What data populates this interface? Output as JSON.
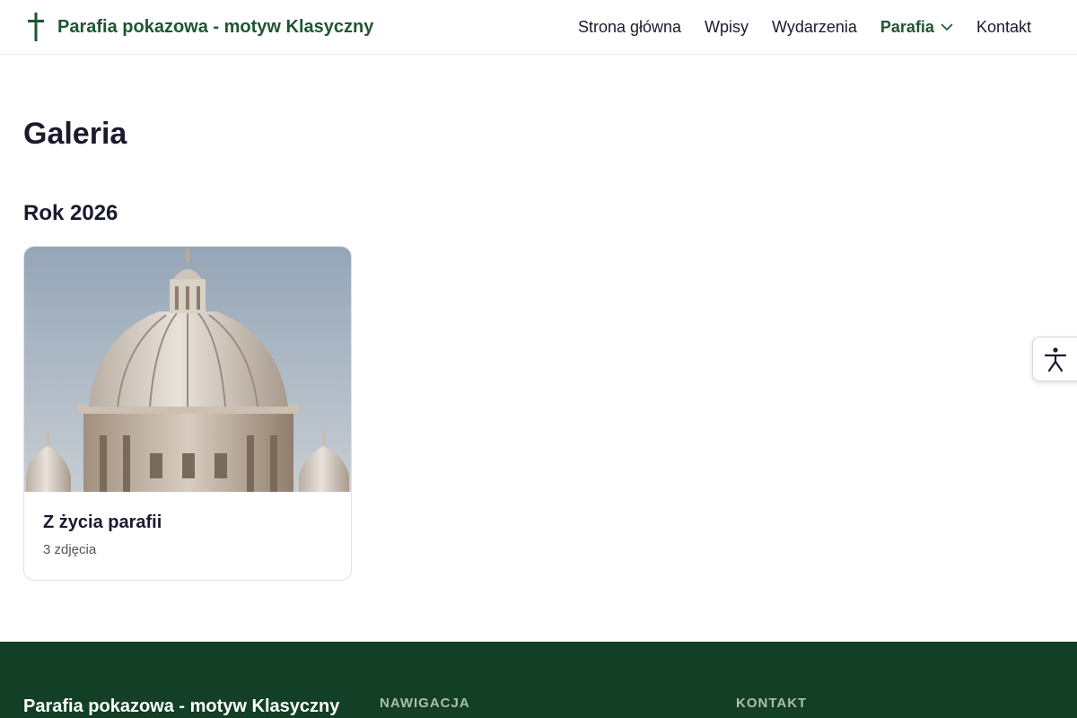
{
  "header": {
    "site_name": "Parafia pokazowa - motyw Klasyczny",
    "logo_icon": "cross-icon",
    "nav": [
      {
        "label": "Strona główna",
        "active": false
      },
      {
        "label": "Wpisy",
        "active": false
      },
      {
        "label": "Wydarzenia",
        "active": false
      },
      {
        "label": "Parafia",
        "active": true,
        "has_dropdown": true
      },
      {
        "label": "Kontakt",
        "active": false
      }
    ]
  },
  "main": {
    "title": "Galeria",
    "sections": [
      {
        "year": "Rok 2026",
        "albums": [
          {
            "title": "Z życia parafii",
            "count": "3 zdjęcia",
            "image": "basilica-dome"
          }
        ]
      }
    ]
  },
  "accessibility": {
    "icon": "accessibility-icon"
  },
  "footer": {
    "site_name": "Parafia pokazowa - motyw Klasyczny",
    "nav_heading": "NAWIGACJA",
    "contact_heading": "KONTAKT"
  },
  "colors": {
    "brand_green": "#1e5631",
    "footer_bg": "#133f26",
    "text_dark": "#1a1a2e"
  }
}
